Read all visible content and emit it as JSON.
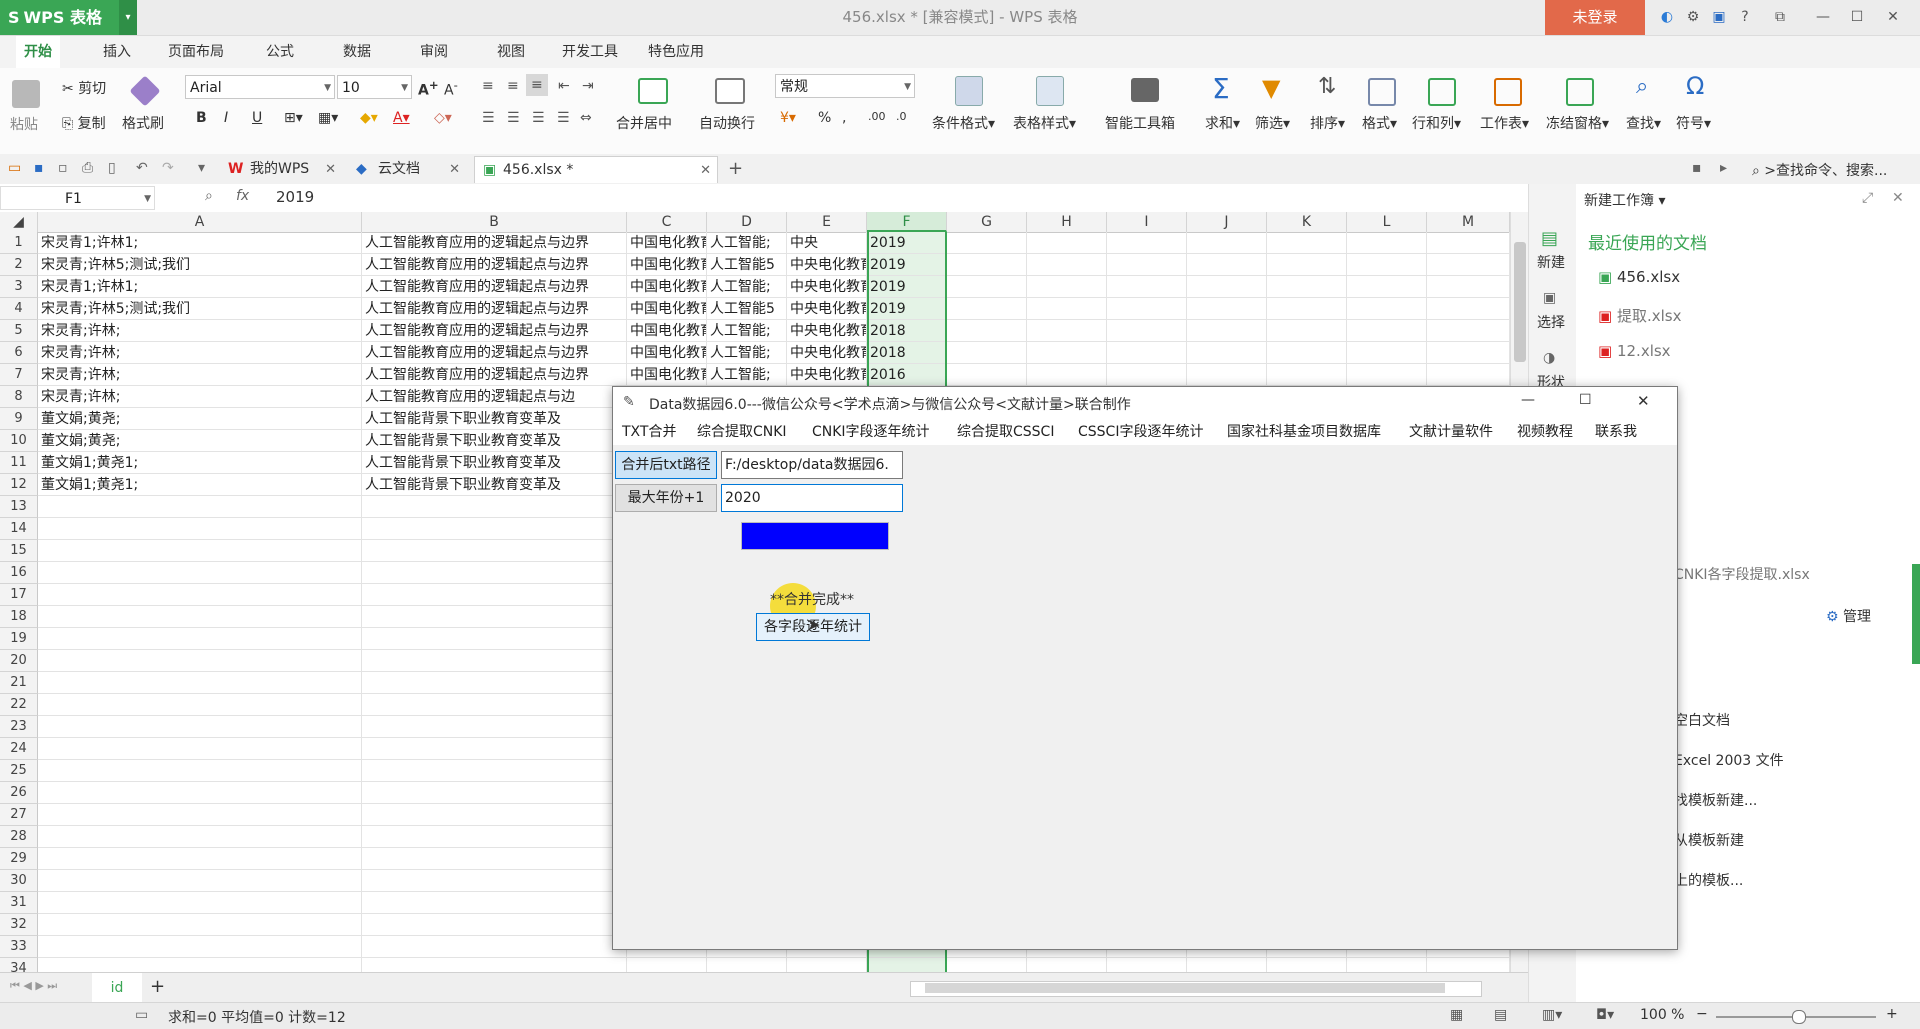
{
  "app": {
    "logo": "WPS 表格",
    "logo_s": "S",
    "title": "456.xlsx * [兼容模式] - WPS 表格",
    "login": "未登录"
  },
  "menu_tabs": [
    "开始",
    "插入",
    "页面布局",
    "公式",
    "数据",
    "审阅",
    "视图",
    "开发工具",
    "特色应用"
  ],
  "ribbon": {
    "paste": "粘贴",
    "cut": "剪切",
    "copy": "复制",
    "format_painter": "格式刷",
    "font": "Arial",
    "font_size": "10",
    "merge_center": "合并居中",
    "auto_wrap": "自动换行",
    "number_format": "常规",
    "percent": "%",
    "cond_format": "条件格式",
    "table_style": "表格样式",
    "smart_toolbox": "智能工具箱",
    "sum": "求和",
    "filter": "筛选",
    "sort": "排序",
    "format": "格式",
    "row_col": "行和列",
    "worksheet": "工作表",
    "freeze": "冻结窗格",
    "find": "查找",
    "symbol": "符号",
    "bold": "B",
    "italic": "I",
    "underline": "U"
  },
  "doc_tabs": [
    "我的WPS",
    "云文档",
    "456.xlsx *"
  ],
  "search_cmd": ">查找命令、搜索...",
  "formula": {
    "cell_ref": "F1",
    "fx": "fx",
    "value": "2019"
  },
  "columns": [
    "A",
    "B",
    "C",
    "D",
    "E",
    "F",
    "G",
    "H",
    "I",
    "J",
    "K",
    "L",
    "M"
  ],
  "rows": [
    [
      "宋灵青1;许林1;",
      "人工智能教育应用的逻辑起点与边界",
      "中国电化教育",
      "人工智能;",
      "中央",
      "2019"
    ],
    [
      "宋灵青;许林5;测试;我们",
      "人工智能教育应用的逻辑起点与边界",
      "中国电化教育",
      "人工智能5",
      "中央电化教育",
      "2019"
    ],
    [
      "宋灵青1;许林1;",
      "人工智能教育应用的逻辑起点与边界",
      "中国电化教育",
      "人工智能;",
      "中央电化教育",
      "2019"
    ],
    [
      "宋灵青;许林5;测试;我们",
      "人工智能教育应用的逻辑起点与边界",
      "中国电化教育",
      "人工智能5",
      "中央电化教育",
      "2019"
    ],
    [
      "宋灵青;许林;",
      "人工智能教育应用的逻辑起点与边界",
      "中国电化教育",
      "人工智能;",
      "中央电化教育",
      "2018"
    ],
    [
      "宋灵青;许林;",
      "人工智能教育应用的逻辑起点与边界",
      "中国电化教育",
      "人工智能;",
      "中央电化教育",
      "2018"
    ],
    [
      "宋灵青;许林;",
      "人工智能教育应用的逻辑起点与边界",
      "中国电化教育",
      "人工智能;",
      "中央电化教育",
      "2016"
    ],
    [
      "宋灵青;许林;",
      "人工智能教育应用的逻辑起点与边",
      "",
      "",
      "",
      ""
    ],
    [
      "董文娟;黄尧;",
      "人工智能背景下职业教育变革及",
      "",
      "",
      "",
      ""
    ],
    [
      "董文娟;黄尧;",
      "人工智能背景下职业教育变革及",
      "",
      "",
      "",
      ""
    ],
    [
      "董文娟1;黄尧1;",
      "人工智能背景下职业教育变革及",
      "",
      "",
      "",
      ""
    ],
    [
      "董文娟1;黄尧1;",
      "人工智能背景下职业教育变革及",
      "",
      "",
      "",
      ""
    ]
  ],
  "row_numbers": [
    "1",
    "2",
    "3",
    "4",
    "5",
    "6",
    "7",
    "8",
    "9",
    "10",
    "11",
    "12",
    "13",
    "14",
    "15",
    "16",
    "17",
    "18",
    "19",
    "20",
    "21",
    "22",
    "23",
    "24",
    "25",
    "26",
    "27",
    "28",
    "29",
    "30",
    "31",
    "32",
    "33",
    "34"
  ],
  "sheet": {
    "name": "id",
    "add": "+"
  },
  "status": {
    "summary": "求和=0  平均值=0  计数=12",
    "zoom": "100 %"
  },
  "sidebar": {
    "new": "新建",
    "select": "选择",
    "shape": "形状"
  },
  "right_panel": {
    "header": "新建工作簿",
    "recent_title": "最近使用的文档",
    "recent": [
      "456.xlsx",
      "提取.xlsx",
      "12.xlsx"
    ],
    "partial": [
      "CNKI各字段提取.xlsx",
      "空白文档",
      "Excel 2003 文件",
      "找模板新建...",
      "从模板新建",
      "上的模板..."
    ],
    "manage": "管理"
  },
  "dialog": {
    "title": "Data数据园6.0---微信公众号<学术点滴>与微信公众号<文献计量>联合制作",
    "menu": [
      "TXT合并",
      "综合提取CNKI",
      "CNKI字段逐年统计",
      "综合提取CSSCI",
      "CSSCI字段逐年统计",
      "国家社科基金项目数据库",
      "文献计量软件",
      "视频教程",
      "联系我"
    ],
    "path_label": "合并后txt路径",
    "path_value": "F:/desktop/data数据园6.",
    "year_label": "最大年份+1",
    "year_value": "2020",
    "progress": 1.0,
    "status": "**合并完成**",
    "stat_button": "各字段逐年统计"
  },
  "colors": {
    "brand": "#3aa655",
    "login": "#e2694a",
    "progress": "#0000ff",
    "selected_col": "#e4f3e6"
  }
}
